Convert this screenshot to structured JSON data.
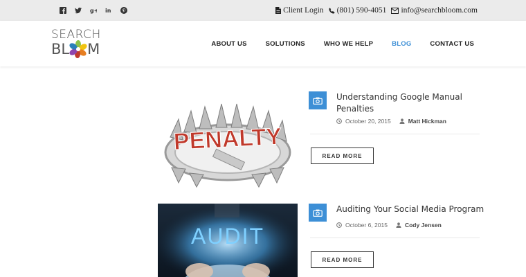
{
  "social": [
    {
      "icon": "facebook-icon"
    },
    {
      "icon": "twitter-icon"
    },
    {
      "icon": "google-plus-icon"
    },
    {
      "icon": "linkedin-icon"
    },
    {
      "icon": "pinterest-icon"
    }
  ],
  "contact": {
    "client_login": "Client Login",
    "phone": "(801) 590-4051",
    "email": "info@searchbloom.com"
  },
  "logo": {
    "line1": "SEARCH",
    "line2_left": "BL",
    "line2_right": "M"
  },
  "nav": {
    "items": [
      {
        "label": "ABOUT US"
      },
      {
        "label": "SOLUTIONS"
      },
      {
        "label": "WHO WE HELP"
      },
      {
        "label": "BLOG"
      },
      {
        "label": "CONTACT US"
      }
    ],
    "active": "BLOG"
  },
  "posts": [
    {
      "image_text": "PENALTY",
      "title": "Understanding Google Manual Penalties",
      "date": "October 20, 2015",
      "author": "Matt Hickman",
      "button": "READ MORE"
    },
    {
      "image_text": "AUDIT",
      "title": "Auditing Your Social Media Program",
      "date": "October 6, 2015",
      "author": "Cody Jensen",
      "button": "READ MORE"
    }
  ],
  "colors": {
    "accent": "#3d8fd6",
    "topbar": "#ebebeb",
    "text": "#333333"
  }
}
